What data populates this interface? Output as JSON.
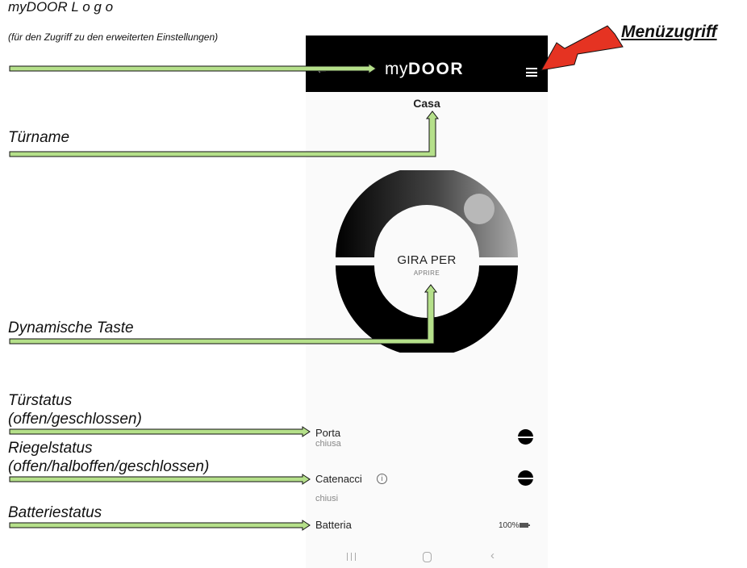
{
  "annotations": {
    "logo_title": "myDOOR L o g o",
    "logo_subtitle": "(für den Zugriff zu den erweiterten Einstellungen)",
    "menu_access": "Menüzugriff",
    "door_name": "Türname",
    "dynamic_button": "Dynamische Taste",
    "door_status_line1": "Türstatus",
    "door_status_line2": "(offen/geschlossen)",
    "bolt_status_line1": "Riegelstatus",
    "bolt_status_line2": "(offen/halboffen/geschlossen)",
    "battery_status": "Batteriestatus"
  },
  "colors": {
    "callout_arrow_fill": "#b5e08a",
    "menu_arrow": "#e53322",
    "app_bar": "#000000",
    "dial_ring": "#000000"
  },
  "app": {
    "back_icon": "back-arrow-icon",
    "logo_prefix": "my",
    "logo_brand": "DOOR",
    "menu_icon": "hamburger-icon",
    "door_name": "Casa",
    "dial": {
      "label": "GIRA PER",
      "sublabel": "APRIRE"
    },
    "status": {
      "door_label": "Porta",
      "door_value": "chiusa",
      "bolts_label": "Catenacci",
      "bolts_value": "chiusi",
      "info_icon": "info-icon",
      "battery_label": "Batteria",
      "battery_value": "100%",
      "battery_level": 1.0
    },
    "system_nav": {
      "recents_icon": "recents-icon",
      "home_icon": "home-icon",
      "back_icon": "nav-back-icon"
    }
  }
}
